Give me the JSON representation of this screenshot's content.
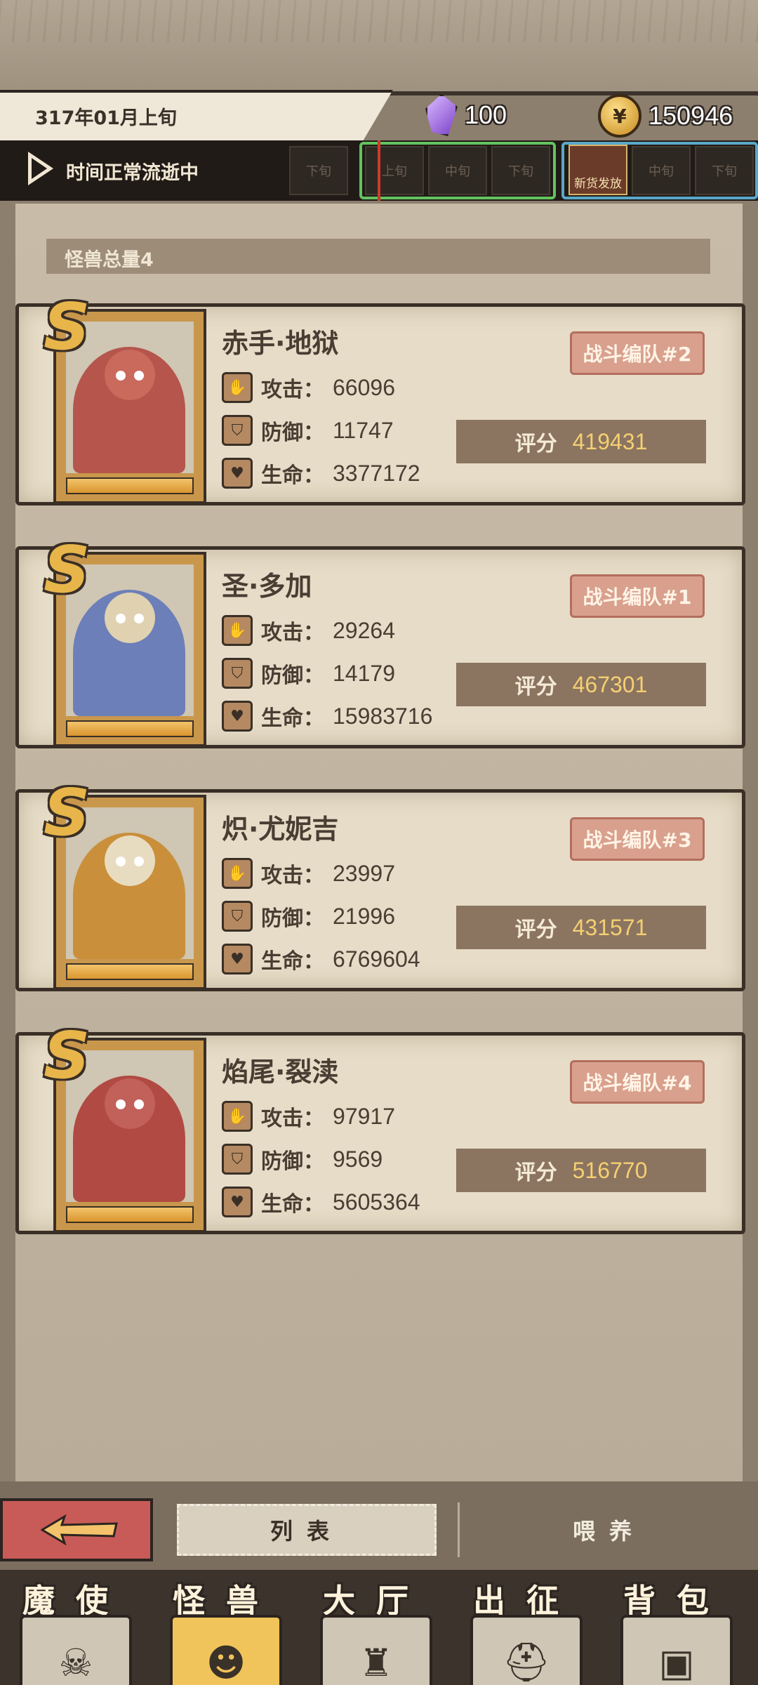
{
  "header": {
    "date": "317年01月上旬",
    "crystals": "100",
    "gold": "150946"
  },
  "timebar": {
    "status": "时间正常流逝中",
    "cells": [
      "下旬",
      "上旬",
      "中旬",
      "下旬",
      "新货发放",
      "中旬",
      "下旬"
    ]
  },
  "monster_total": "怪兽总量4",
  "stat_labels": {
    "attack": "攻击：",
    "defense": "防御：",
    "hp": "生命：",
    "score": "评分"
  },
  "monsters": [
    {
      "rank": "S",
      "name": "赤手·地狱",
      "attack": "66096",
      "defense": "11747",
      "hp": "3377172",
      "team": "战斗编队#2",
      "score": "419431"
    },
    {
      "rank": "S",
      "name": "圣·多加",
      "attack": "29264",
      "defense": "14179",
      "hp": "15983716",
      "team": "战斗编队#1",
      "score": "467301"
    },
    {
      "rank": "S",
      "name": "炽·尤妮吉",
      "attack": "23997",
      "defense": "21996",
      "hp": "6769604",
      "team": "战斗编队#3",
      "score": "431571"
    },
    {
      "rank": "S",
      "name": "焰尾·裂渎",
      "attack": "97917",
      "defense": "9569",
      "hp": "5605364",
      "team": "战斗编队#4",
      "score": "516770"
    }
  ],
  "tabs": {
    "list": "列表",
    "feed": "喂养"
  },
  "nav": [
    "魔使",
    "怪兽",
    "大厅",
    "出征",
    "背包"
  ],
  "colors": {
    "accent": "#f1c45b",
    "team_badge": "#d9a08e",
    "score_value": "#f5cf72",
    "back_button": "#c85b57"
  }
}
